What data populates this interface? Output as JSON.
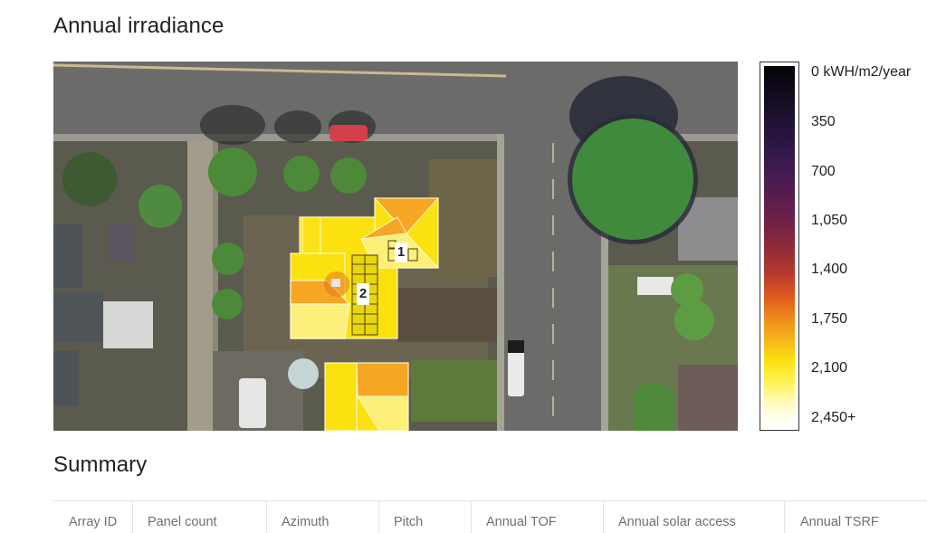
{
  "page": {
    "irradiance_title": "Annual irradiance",
    "summary_title": "Summary"
  },
  "map": {
    "description": "Aerial satellite view with roof irradiance overlay",
    "array_labels": [
      "1",
      "2"
    ],
    "colors": {
      "roof_yellow": "#fbe10f",
      "roof_orange": "#f5a623",
      "roof_pale": "#fdf07a",
      "tree_overlay": "#3f8a3c",
      "road": "#6d6d6b"
    }
  },
  "legend": {
    "unit": "kWH/m2/year",
    "labels": [
      "0 kWH/m2/year",
      "350",
      "700",
      "1,050",
      "1,400",
      "1,750",
      "2,100",
      "2,450+"
    ],
    "min": 0,
    "max": 2450,
    "max_suffix": "+"
  },
  "summary_table": {
    "columns": [
      "Array ID",
      "Panel count",
      "Azimuth",
      "Pitch",
      "Annual TOF",
      "Annual solar access",
      "Annual TSRF"
    ],
    "rows": []
  }
}
